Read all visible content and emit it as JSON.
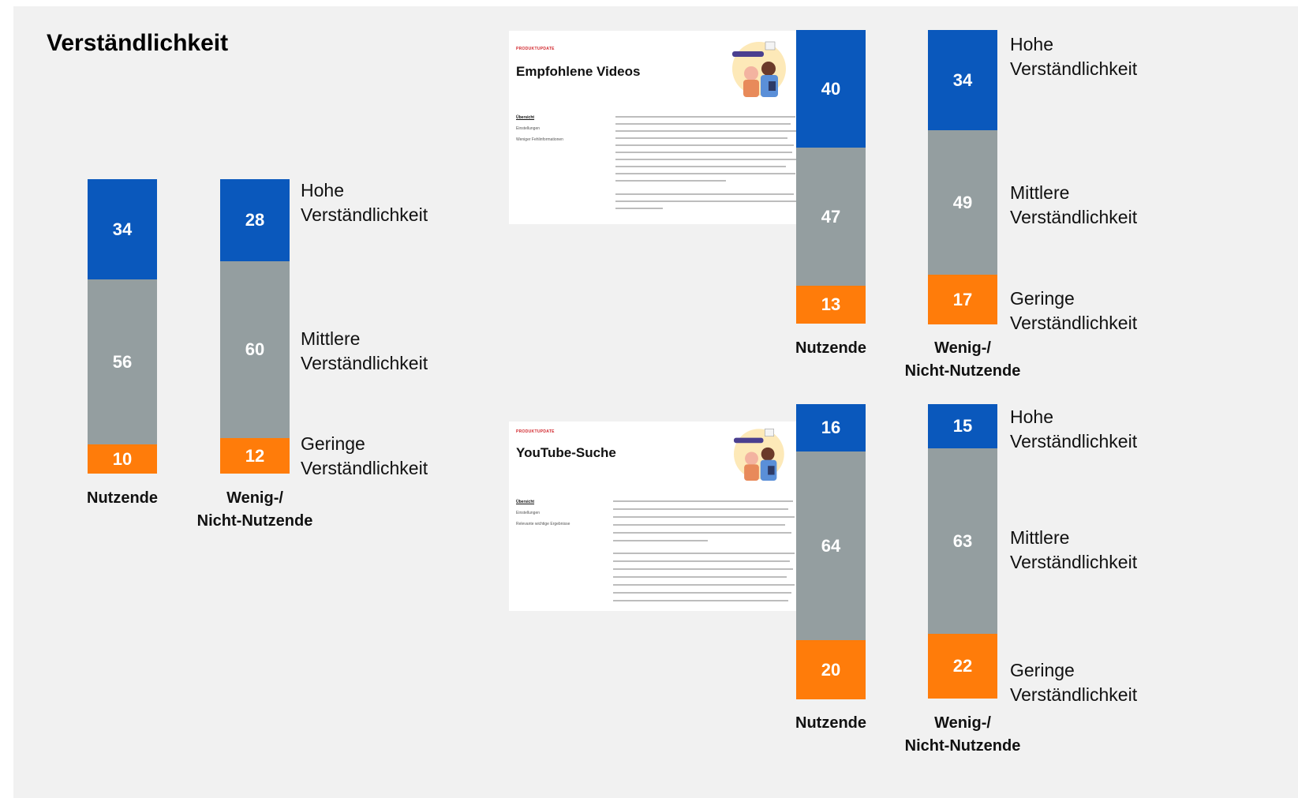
{
  "title": "Verständlichkeit",
  "colors": {
    "hoch": "#0a58bc",
    "mittel": "#949ea0",
    "gering": "#ff7c0a"
  },
  "legend": {
    "hoch": "Hohe\nVerständlichkeit",
    "mittel": "Mittlere\nVerständlichkeit",
    "gering": "Geringe\nVerständlichkeit"
  },
  "cards": [
    {
      "kicker": "PRODUKTUPDATE",
      "title": "Empfohlene Videos",
      "nav": [
        "Übersicht",
        "Einstellungen",
        "Weniger Fehlinformationen"
      ]
    },
    {
      "kicker": "PRODUKTUPDATE",
      "title": "YouTube-Suche",
      "nav": [
        "Übersicht",
        "Einstellungen",
        "Relevante wichtige Ergebnisse"
      ]
    }
  ],
  "chart_data": [
    {
      "type": "bar",
      "stacked": true,
      "title": "Verständlichkeit",
      "categories": [
        "Nutzende",
        "Wenig-/\nNicht-Nutzende"
      ],
      "series": [
        {
          "name": "Hohe Verständlichkeit",
          "values": [
            34,
            28
          ]
        },
        {
          "name": "Mittlere Verständlichkeit",
          "values": [
            56,
            60
          ]
        },
        {
          "name": "Geringe Verständlichkeit",
          "values": [
            10,
            12
          ]
        }
      ]
    },
    {
      "type": "bar",
      "stacked": true,
      "title": "Empfohlene Videos",
      "categories": [
        "Nutzende",
        "Wenig-/\nNicht-Nutzende"
      ],
      "series": [
        {
          "name": "Hohe Verständlichkeit",
          "values": [
            40,
            34
          ]
        },
        {
          "name": "Mittlere Verständlichkeit",
          "values": [
            47,
            49
          ]
        },
        {
          "name": "Geringe Verständlichkeit",
          "values": [
            13,
            17
          ]
        }
      ]
    },
    {
      "type": "bar",
      "stacked": true,
      "title": "YouTube-Suche",
      "categories": [
        "Nutzende",
        "Wenig-/\nNicht-Nutzende"
      ],
      "series": [
        {
          "name": "Hohe Verständlichkeit",
          "values": [
            16,
            15
          ]
        },
        {
          "name": "Mittlere Verständlichkeit",
          "values": [
            64,
            63
          ]
        },
        {
          "name": "Geringe Verständlichkeit",
          "values": [
            20,
            22
          ]
        }
      ]
    }
  ]
}
